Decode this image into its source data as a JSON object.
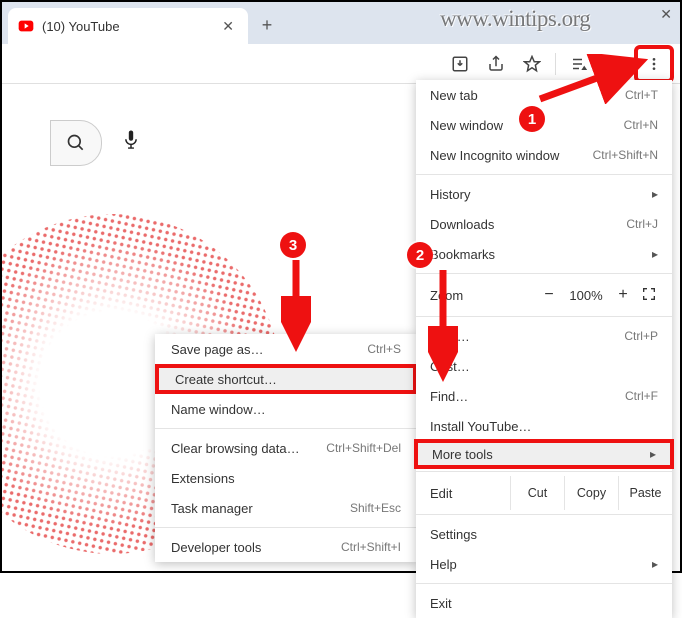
{
  "watermark": "www.wintips.org",
  "tab": {
    "title": "(10) YouTube"
  },
  "search": {
    "placeholder": "Search"
  },
  "annotations": {
    "c1": "1",
    "c2": "2",
    "c3": "3"
  },
  "menu": {
    "newTab": {
      "label": "New tab",
      "shortcut": "Ctrl+T"
    },
    "newWindow": {
      "label": "New window",
      "shortcut": "Ctrl+N"
    },
    "newIncognito": {
      "label": "New Incognito window",
      "shortcut": "Ctrl+Shift+N"
    },
    "history": {
      "label": "History"
    },
    "downloads": {
      "label": "Downloads",
      "shortcut": "Ctrl+J"
    },
    "bookmarks": {
      "label": "Bookmarks"
    },
    "zoom": {
      "label": "Zoom",
      "minus": "−",
      "value": "100%",
      "plus": "+"
    },
    "print": {
      "label": "Print…",
      "shortcut": "Ctrl+P"
    },
    "cast": {
      "label": "Cast…"
    },
    "find": {
      "label": "Find…",
      "shortcut": "Ctrl+F"
    },
    "install": {
      "label": "Install YouTube…"
    },
    "moreTools": {
      "label": "More tools"
    },
    "edit": {
      "label": "Edit",
      "cut": "Cut",
      "copy": "Copy",
      "paste": "Paste"
    },
    "settings": {
      "label": "Settings"
    },
    "help": {
      "label": "Help"
    },
    "exit": {
      "label": "Exit"
    }
  },
  "sub": {
    "savePage": {
      "label": "Save page as…",
      "shortcut": "Ctrl+S"
    },
    "createShort": {
      "label": "Create shortcut…"
    },
    "nameWindow": {
      "label": "Name window…"
    },
    "clearData": {
      "label": "Clear browsing data…",
      "shortcut": "Ctrl+Shift+Del"
    },
    "extensions": {
      "label": "Extensions"
    },
    "taskManager": {
      "label": "Task manager",
      "shortcut": "Shift+Esc"
    },
    "devTools": {
      "label": "Developer tools",
      "shortcut": "Ctrl+Shift+I"
    }
  }
}
